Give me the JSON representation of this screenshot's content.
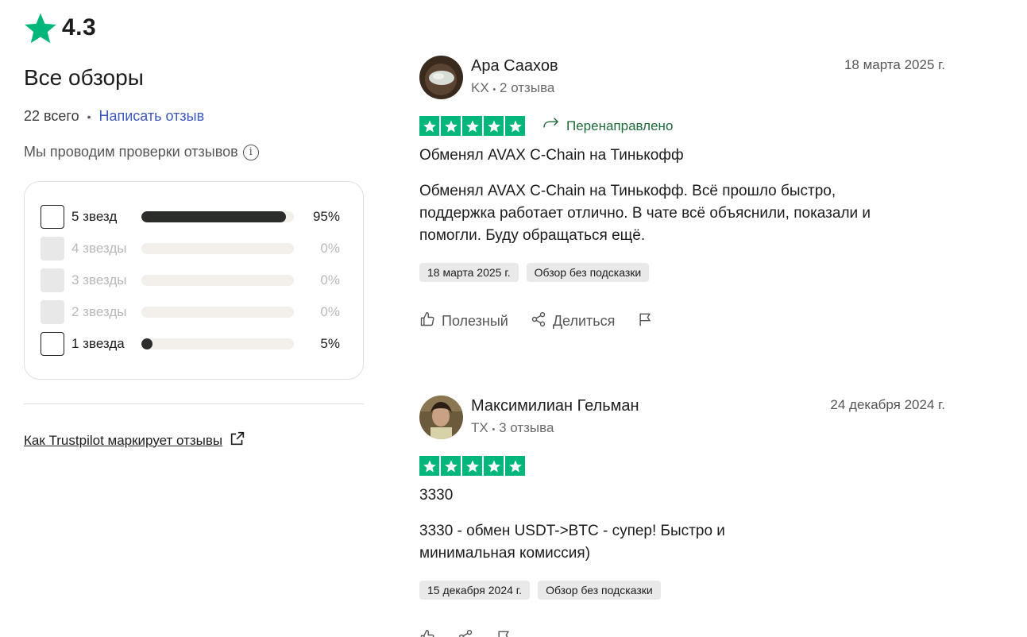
{
  "rating": {
    "score": "4.3",
    "icon": "star-icon",
    "color": "#00b67a"
  },
  "left": {
    "title": "Все обзоры",
    "total": "22 всего",
    "write_review": "Написать отзыв",
    "checks_text": "Мы проводим проверки отзывов",
    "distribution": [
      {
        "label": "5 звезд",
        "percent": "95%",
        "fraction": 0.95,
        "enabled": true
      },
      {
        "label": "4 звезды",
        "percent": "0%",
        "fraction": 0,
        "enabled": false
      },
      {
        "label": "3 звезды",
        "percent": "0%",
        "fraction": 0,
        "enabled": false
      },
      {
        "label": "2 звезды",
        "percent": "0%",
        "fraction": 0,
        "enabled": false
      },
      {
        "label": "1 звезда",
        "percent": "5%",
        "fraction": 0.05,
        "enabled": true
      }
    ],
    "how_link": "Как Trustpilot маркирует отзывы"
  },
  "reviews": [
    {
      "author": "Ара Саахов",
      "country": "KX",
      "review_count": "2 отзыва",
      "date": "18 марта 2025 г.",
      "stars": 5,
      "redirect": "Перенаправлено",
      "title": "Обменял AVAX C-Chain на Тинькофф",
      "body_lines": [
        "Обменял AVAX C-Chain на Тинькофф. Всё прошло быстро,",
        "поддержка работает отлично. В чате всё объяснили, показали и",
        "помогли. Буду обращаться ещё."
      ],
      "tag_date": "18 марта 2025 г.",
      "tag_type": "Обзор без подсказки",
      "useful": "Полезный",
      "share": "Делиться"
    },
    {
      "author": "Максимилиан Гельман",
      "country": "TX",
      "review_count": "3 отзыва",
      "date": "24 декабря 2024 г.",
      "stars": 5,
      "title": "3330",
      "body_lines": [
        "3330 - обмен USDT->BTC - супер! Быстро и",
        "минимальная комиссия)"
      ],
      "tag_date": "15 декабря 2024 г.",
      "tag_type": "Обзор без подсказки"
    }
  ],
  "separator": "•"
}
